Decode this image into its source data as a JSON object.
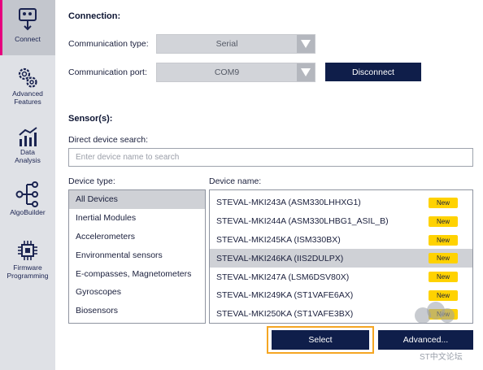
{
  "sidebar": {
    "items": [
      {
        "label": "Connect",
        "icon": "connect-icon",
        "active": true
      },
      {
        "label": "Advanced Features",
        "icon": "gears-icon",
        "active": false
      },
      {
        "label": "Data Analysis",
        "icon": "bar-chart-icon",
        "active": false
      },
      {
        "label": "AlgoBuilder",
        "icon": "algo-tree-icon",
        "active": false
      },
      {
        "label": "Firmware Programming",
        "icon": "chip-icon",
        "active": false
      }
    ]
  },
  "connection": {
    "title": "Connection:",
    "type_label": "Communication type:",
    "type_value": "Serial",
    "port_label": "Communication port:",
    "port_value": "COM9",
    "disconnect_label": "Disconnect"
  },
  "sensors": {
    "title": "Sensor(s):",
    "search_label": "Direct device search:",
    "search_placeholder": "Enter device name to search",
    "device_type_label": "Device type:",
    "device_name_label": "Device name:",
    "device_types": [
      {
        "label": "All Devices",
        "selected": true
      },
      {
        "label": "Inertial Modules",
        "selected": false
      },
      {
        "label": "Accelerometers",
        "selected": false
      },
      {
        "label": "Environmental sensors",
        "selected": false
      },
      {
        "label": "E-compasses, Magnetometers",
        "selected": false
      },
      {
        "label": "Gyroscopes",
        "selected": false
      },
      {
        "label": "Biosensors",
        "selected": false
      }
    ],
    "devices": [
      {
        "name": "STEVAL-MKI243A (ASM330LHHXG1)",
        "badge": "New",
        "selected": false
      },
      {
        "name": "STEVAL-MKI244A (ASM330LHBG1_ASIL_B)",
        "badge": "New",
        "selected": false
      },
      {
        "name": "STEVAL-MKI245KA (ISM330BX)",
        "badge": "New",
        "selected": false
      },
      {
        "name": "STEVAL-MKI246KA (IIS2DULPX)",
        "badge": "New",
        "selected": true
      },
      {
        "name": "STEVAL-MKI247A (LSM6DSV80X)",
        "badge": "New",
        "selected": false
      },
      {
        "name": "STEVAL-MKI249KA (ST1VAFE6AX)",
        "badge": "New",
        "selected": false
      },
      {
        "name": "STEVAL-MKI250KA (ST1VAFE3BX)",
        "badge": "New",
        "selected": false
      }
    ],
    "select_label": "Select",
    "advanced_label": "Advanced..."
  },
  "watermark": "ST中文论坛",
  "colors": {
    "accent": "#e6007e",
    "primary_button": "#0f1e4a",
    "badge": "#ffd200",
    "highlight_frame": "#f5a623"
  }
}
